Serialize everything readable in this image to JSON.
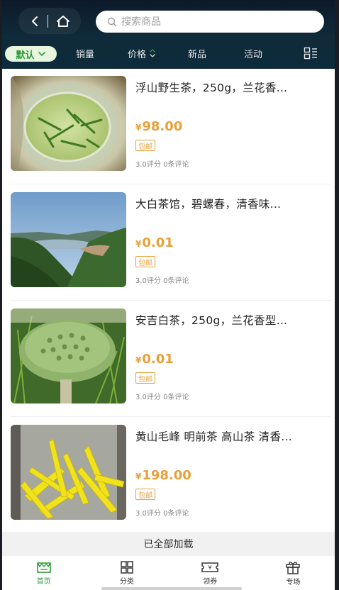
{
  "header": {
    "search_placeholder": "搜索商品"
  },
  "filters": {
    "default": "默认",
    "sales": "销量",
    "price": "价格",
    "new": "新品",
    "activity": "活动"
  },
  "products": [
    {
      "title": "浮山野生茶，250g，兰花香…",
      "yen": "¥",
      "price": "98.00",
      "tag": "包邮",
      "meta": "3.0评分 0条评论"
    },
    {
      "title": "大白茶馆，碧螺春，清香味…",
      "yen": "¥",
      "price": "0.01",
      "tag": "包邮",
      "meta": "3.0评分 0条评论"
    },
    {
      "title": "安吉白茶，250g，兰花香型…",
      "yen": "¥",
      "price": "0.01",
      "tag": "包邮",
      "meta": "3.0评分 0条评论"
    },
    {
      "title": "黄山毛峰 明前茶 高山茶 清香…",
      "yen": "¥",
      "price": "198.00",
      "tag": "包邮",
      "meta": "3.0评分 0条评论"
    }
  ],
  "footer": {
    "loaded": "已全部加载"
  },
  "tabbar": {
    "home": "首页",
    "category": "分类",
    "coupon": "领券",
    "special": "专场"
  },
  "colors": {
    "accent_green": "#2f9a3a",
    "price_orange": "#e8a03a",
    "header_dark": "#0f2b3a"
  }
}
